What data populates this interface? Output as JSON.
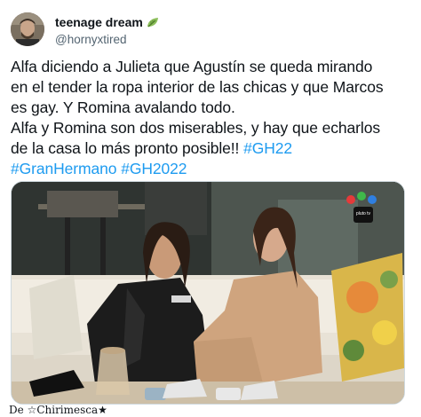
{
  "tweet": {
    "display_name": "teenage dream",
    "name_emoji": "leaf-icon",
    "handle": "@hornyxtired",
    "text_lines": [
      "Alfa diciendo a Julieta que Agustín se queda mirando",
      "en el tender la ropa interior de las chicas y que Marcos",
      "es gay. Y Romina avalando todo.",
      "Alfa y Romina son dos miserables, y hay que echarlos"
    ],
    "line5_text": "de la casa lo más pronto posible!! ",
    "hashtag_gh22": "#GH22",
    "hashtag_granhermano": "#GranHermano",
    "hashtag_gh2022": "#GH2022",
    "media_alt": "Two women sitting on a couch in the Gran Hermano house",
    "media_logo": "pluto tv",
    "accent_color": "#1d9bf0"
  },
  "footer": {
    "prefix": "De",
    "source": "☆Chirimesca★"
  }
}
